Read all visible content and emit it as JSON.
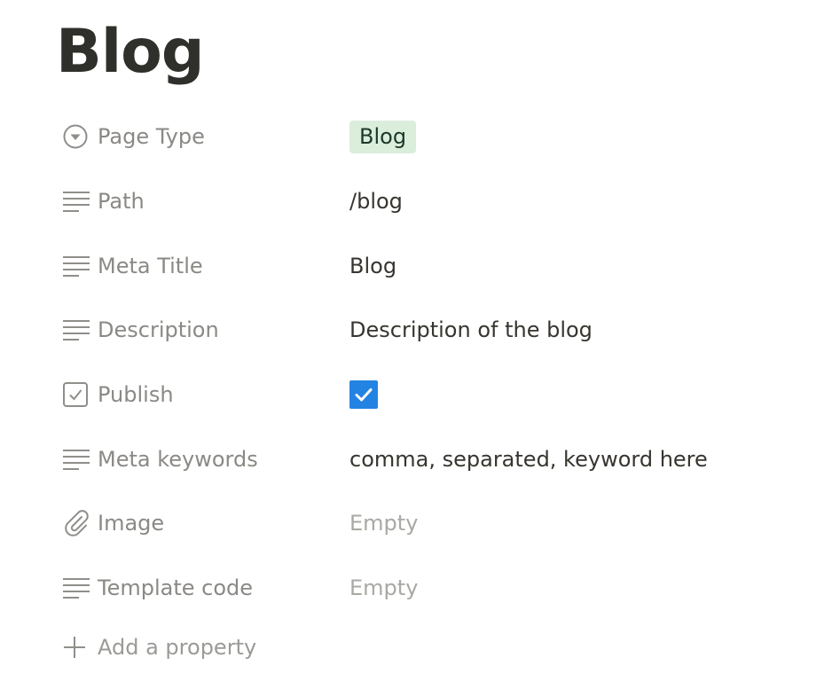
{
  "page": {
    "title": "Blog"
  },
  "properties": [
    {
      "label": "Page Type",
      "icon": "select-circle-icon",
      "value": "Blog",
      "kind": "tag",
      "tag_color": "#dbeddb"
    },
    {
      "label": "Path",
      "icon": "text-lines-icon",
      "value": "/blog",
      "kind": "text"
    },
    {
      "label": "Meta Title",
      "icon": "text-lines-icon",
      "value": "Blog",
      "kind": "text"
    },
    {
      "label": "Description",
      "icon": "text-lines-icon",
      "value": "Description of the blog",
      "kind": "text"
    },
    {
      "label": "Publish",
      "icon": "checkbox-icon",
      "value": true,
      "kind": "checkbox"
    },
    {
      "label": "Meta keywords",
      "icon": "text-lines-icon",
      "value": "comma, separated, keyword here",
      "kind": "text"
    },
    {
      "label": "Image",
      "icon": "paperclip-icon",
      "value": "Empty",
      "kind": "empty"
    },
    {
      "label": "Template code",
      "icon": "text-lines-icon",
      "value": "Empty",
      "kind": "empty"
    }
  ],
  "add_property": {
    "label": "Add a property",
    "icon": "plus-icon"
  },
  "colors": {
    "accent": "#2383e2",
    "tag_bg": "#dbeddb",
    "label": "#8a8985",
    "text": "#37352f"
  }
}
